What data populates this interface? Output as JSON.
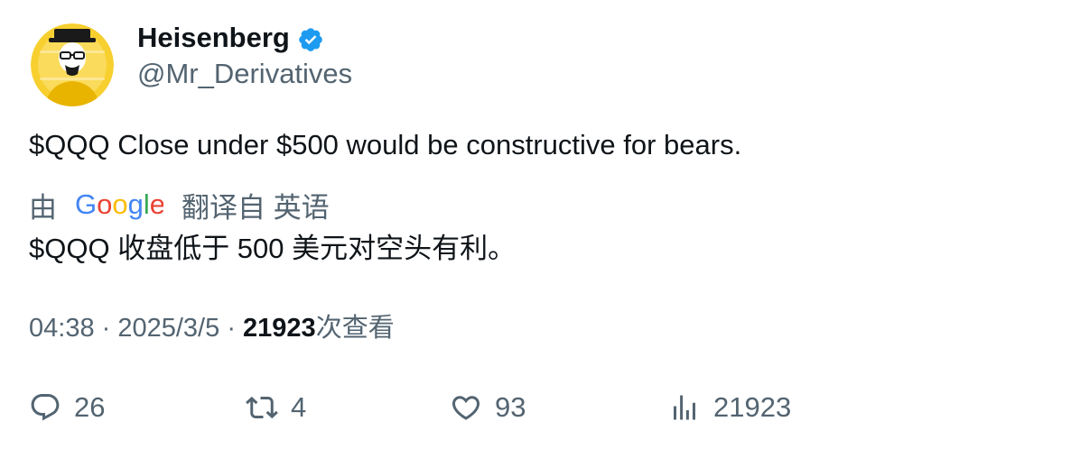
{
  "author": {
    "name": "Heisenberg",
    "handle": "@Mr_Derivatives",
    "avatar_icon": "heisenberg-avatar",
    "verified_color": "#1d9bf0"
  },
  "tweet": {
    "text": "$QQQ Close under $500 would be constructive for bears."
  },
  "translation": {
    "prefix": "由",
    "provider": "Google",
    "suffix": "翻译自 英语",
    "text": "$QQQ 收盘低于 500 美元对空头有利。"
  },
  "meta": {
    "time": "04:38",
    "separator": "·",
    "date": "2025/3/5",
    "views": "21923",
    "views_label": "次查看"
  },
  "actions": {
    "reply_count": "26",
    "retweet_count": "4",
    "like_count": "93",
    "views_count": "21923"
  },
  "colors": {
    "text_primary": "#0f1419",
    "text_secondary": "#536471",
    "avatar_bg": "#f7cf2f"
  }
}
